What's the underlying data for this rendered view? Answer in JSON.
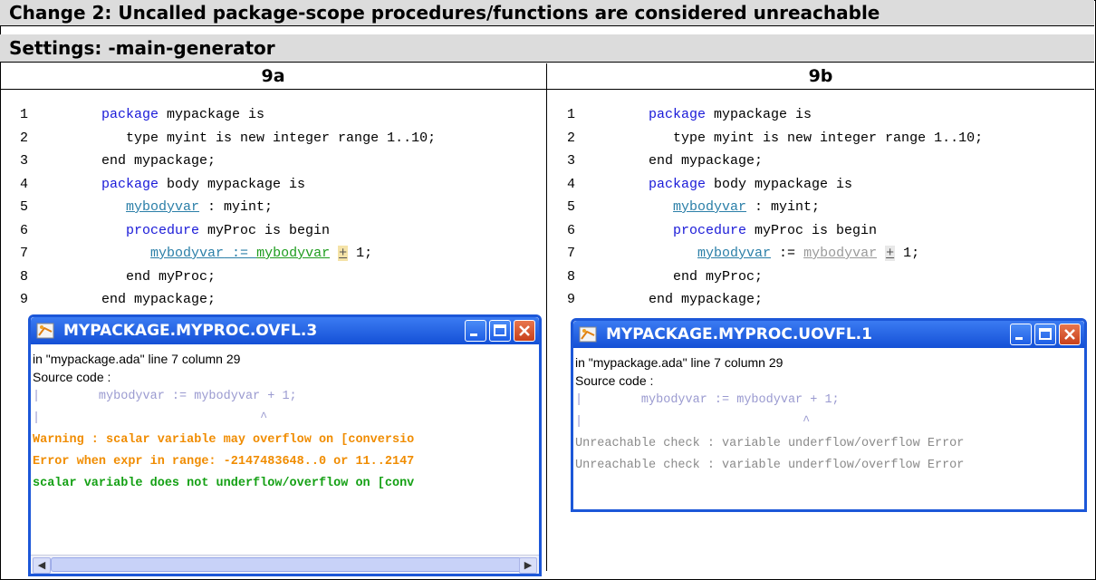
{
  "header": {
    "title": "Change 2: Uncalled package-scope procedures/functions are considered unreachable",
    "settings": "Settings: -main-generator"
  },
  "columns": [
    {
      "label": "9a"
    },
    {
      "label": "9b"
    }
  ],
  "code": {
    "line_numbers": [
      "1",
      "2",
      "3",
      "4",
      "5",
      "6",
      "7",
      "8",
      "9"
    ],
    "l1_kw": "package",
    "l1_rest": " mypackage is",
    "l2": "   type myint is new integer range 1..10;",
    "l3": "end mypackage;",
    "l4_kw": "package",
    "l4_rest": " body mypackage is",
    "l5_var": "mybodyvar",
    "l5_rest": " : myint;",
    "l6_kw": "procedure",
    "l6_rest": " myProc is begin",
    "l7_var1": "mybodyvar",
    "l7_op": " := ",
    "l7_var2": "mybodyvar",
    "l7_plus": "+",
    "l7_rest": " 1;",
    "l8": "end myProc;",
    "l9": "end mypackage;"
  },
  "window_a": {
    "title": "MYPACKAGE.MYPROC.OVFL.3",
    "location": "in \"mypackage.ada\" line 7 column 29",
    "source_label": "Source code :",
    "src_line": "|        mybodyvar := mybodyvar + 1;",
    "caret_line": "|                              ^",
    "warning": "Warning : scalar variable may overflow on [conversio",
    "error": "Error when expr in range: -2147483648..0 or 11..2147",
    "ok": "scalar variable does not underflow/overflow on [conv"
  },
  "window_b": {
    "title": "MYPACKAGE.MYPROC.UOVFL.1",
    "location": "in \"mypackage.ada\" line 7 column 29",
    "source_label": "Source code :",
    "src_line": "|        mybodyvar := mybodyvar + 1;",
    "caret_line": "|                              ^",
    "unreach1": "Unreachable check : variable underflow/overflow Error",
    "unreach2": "Unreachable check : variable underflow/overflow Error"
  }
}
